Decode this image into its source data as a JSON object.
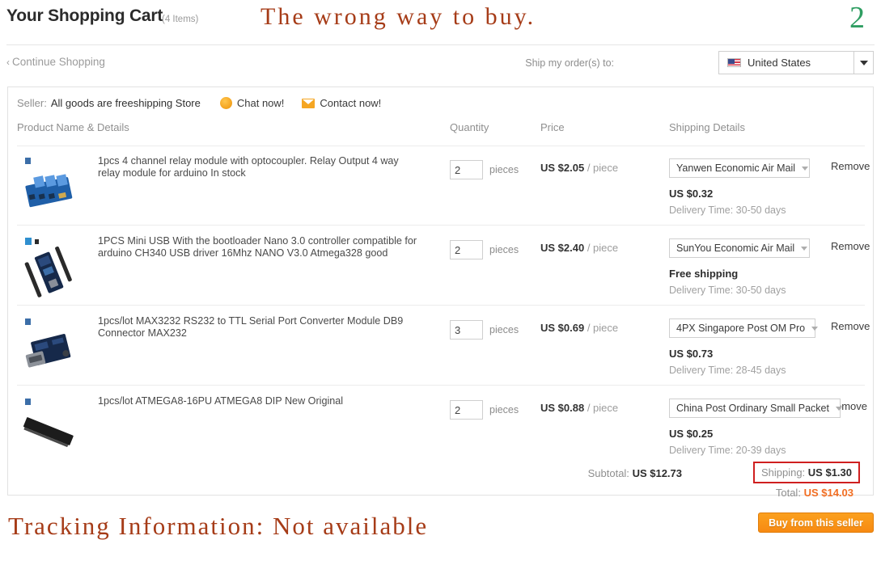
{
  "header": {
    "title": "Your Shopping Cart",
    "item_count": "(4 Items)",
    "annotation_top": "The wrong way to buy.",
    "annotation_number": "2"
  },
  "subheader": {
    "continue_shopping": "Continue Shopping",
    "chevron": "‹",
    "ship_to_label": "Ship my order(s) to:",
    "ship_to_value": "United States"
  },
  "seller": {
    "label": "Seller:",
    "name": "All goods are freeshipping Store",
    "chat_label": "Chat now!",
    "contact_label": "Contact now!"
  },
  "columns": {
    "product": "Product Name & Details",
    "quantity": "Quantity",
    "price": "Price",
    "shipping": "Shipping Details"
  },
  "items": [
    {
      "name": "1pcs 4 channel relay module with optocoupler. Relay Output 4 way relay module for arduino In stock",
      "qty": "2",
      "unit": "pieces",
      "price": "US $2.05",
      "price_per": "/ piece",
      "shipping_method": "Yanwen Economic Air Mail",
      "shipping_cost": "US $0.32",
      "delivery": "Delivery Time: 30-50 days",
      "remove": "Remove"
    },
    {
      "name": "1PCS Mini USB With the bootloader Nano 3.0 controller compatible for arduino CH340 USB driver 16Mhz NANO V3.0 Atmega328 good",
      "qty": "2",
      "unit": "pieces",
      "price": "US $2.40",
      "price_per": "/ piece",
      "shipping_method": "SunYou Economic Air Mail",
      "shipping_cost": "Free shipping",
      "delivery": "Delivery Time: 30-50 days",
      "remove": "Remove"
    },
    {
      "name": "1pcs/lot MAX3232 RS232 to TTL Serial Port Converter Module DB9 Connector MAX232",
      "qty": "3",
      "unit": "pieces",
      "price": "US $0.69",
      "price_per": "/ piece",
      "shipping_method": "4PX Singapore Post OM Pro",
      "shipping_cost": "US $0.73",
      "delivery": "Delivery Time: 28-45 days",
      "remove": "Remove"
    },
    {
      "name": "1pcs/lot ATMEGA8-16PU ATMEGA8 DIP New Original",
      "qty": "2",
      "unit": "pieces",
      "price": "US $0.88",
      "price_per": "/ piece",
      "shipping_method": "China Post Ordinary Small Packet",
      "shipping_cost": "US $0.25",
      "delivery": "Delivery Time: 20-39 days",
      "remove": "emove"
    }
  ],
  "totals": {
    "subtotal_label": "Subtotal:",
    "subtotal_value": "US $12.73",
    "shipping_label": "Shipping:",
    "shipping_value": "US $1.30",
    "total_label": "Total:",
    "total_value": "US $14.03"
  },
  "footer": {
    "annotation_bottom": "Tracking Information: Not available",
    "buy_button": "Buy from this seller"
  },
  "colors": {
    "annotation": "#a63c18",
    "annotation_number": "#2f9e62",
    "total": "#f26d21",
    "highlight_box": "#cf1f1f",
    "buy_button": "#f78a12"
  }
}
